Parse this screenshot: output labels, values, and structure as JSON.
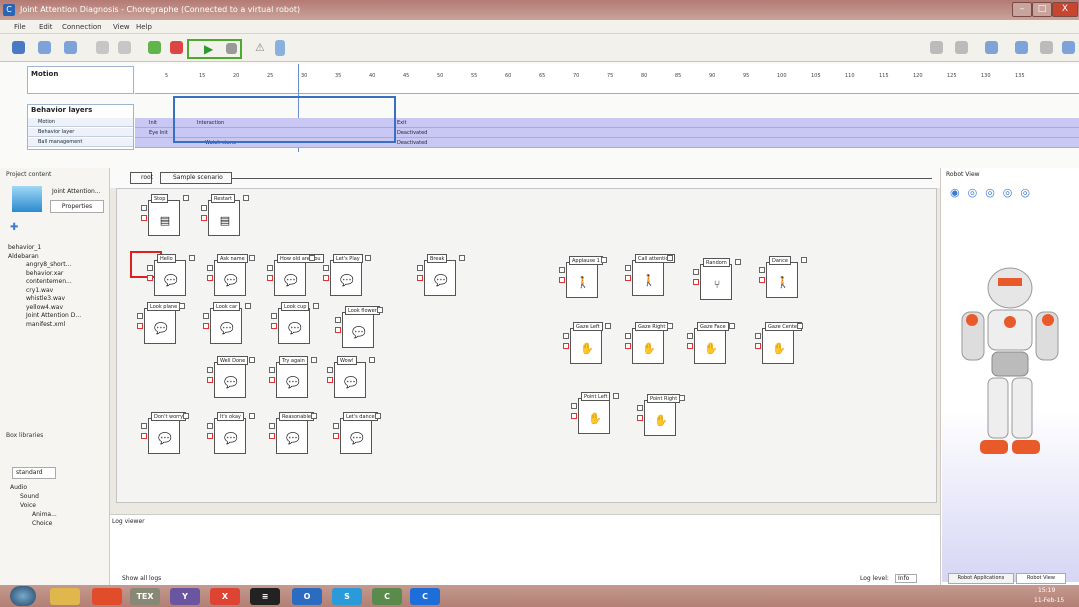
{
  "window": {
    "title": "Joint Attention Diagnosis - Choregraphe (Connected to a virtual robot)",
    "minimize": "–",
    "maximize": "□",
    "close": "X"
  },
  "menu": [
    "File",
    "Edit",
    "Connection",
    "View",
    "Help"
  ],
  "motion": {
    "title": "Motion"
  },
  "behavior_layers": {
    "title": "Behavior layers",
    "layers": [
      "Motion",
      "Behavior layer",
      "Ball management"
    ],
    "rows": [
      {
        "a": "Init",
        "b": "Interaction",
        "c": "Exit"
      },
      {
        "a": "Eye Init",
        "b": "",
        "c": "Deactivated"
      },
      {
        "a": "",
        "b": "Watch stone",
        "c": "Deactivated"
      }
    ]
  },
  "ruler_ticks": [
    "5",
    "15",
    "20",
    "25",
    "30",
    "35",
    "40",
    "45",
    "50",
    "55",
    "60",
    "65",
    "70",
    "75",
    "80",
    "85",
    "90",
    "95",
    "100",
    "105",
    "110",
    "115",
    "120",
    "125",
    "130",
    "135"
  ],
  "project": {
    "title": "Project content",
    "name": "Joint Attention...",
    "properties": "Properties",
    "tree": [
      "behavior_1",
      "Aldebaran",
      "angry8_short...",
      "behavior.xar",
      "contentemen...",
      "cry1.wav",
      "whistle3.wav",
      "yellow4.wav",
      "Joint Attention D...",
      "manifest.xml"
    ]
  },
  "box_libs": {
    "title": "Box libraries",
    "tab": "standard",
    "tree": [
      "Audio",
      "Sound",
      "Voice",
      "Anima...",
      "Choice"
    ]
  },
  "breadcrumb": {
    "root": "root",
    "scenario": "Sample scenario"
  },
  "boxes": {
    "stop": "Stop",
    "restart": "Restart",
    "hello": "Hello",
    "ask_name": "Ask name",
    "how_old": "How old are you",
    "lets_play": "Let's Play",
    "break": "Break",
    "look_plane": "Look plane",
    "look_car": "Look car",
    "look_cup": "Look cup",
    "look_flower": "Look flower",
    "well_done": "Well Done",
    "try_again": "Try again",
    "wow": "Wow!",
    "dont_worry": "Don't worry",
    "its_okay": "It's okay",
    "reasonable": "Reasonable",
    "lets_dance": "Let's dance",
    "applause": "Applause 1",
    "gesture": "Call attention",
    "random": "Random",
    "dance": "Dance",
    "gaze_left": "Gaze Left",
    "gaze_right": "Gaze Right",
    "gaze_face": "Gaze Face",
    "gaze_center": "Gaze Center",
    "point_left": "Point Left",
    "point_right": "Point Right"
  },
  "log": {
    "title": "Log viewer",
    "show_all": "Show all logs",
    "level_label": "Log level:",
    "level": "Info"
  },
  "robot": {
    "title": "Robot View",
    "tab1": "Robot Applications",
    "tab2": "Robot View"
  },
  "taskbar": {
    "time": "15:19",
    "date": "11-Feb-15",
    "apps": [
      "TEX",
      "Y",
      "X",
      "≡",
      "O",
      "S",
      "C",
      "C"
    ]
  }
}
